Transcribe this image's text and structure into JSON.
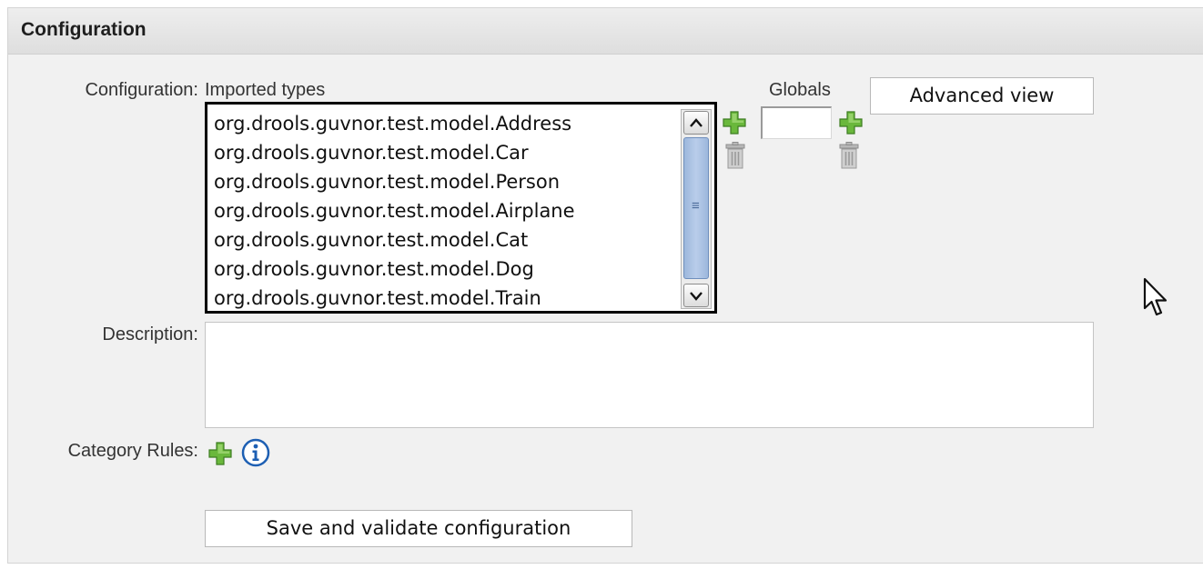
{
  "panel": {
    "title": "Configuration"
  },
  "config": {
    "label": "Configuration:",
    "imported_types_label": "Imported types",
    "imported_types": [
      "org.drools.guvnor.test.model.Address",
      "org.drools.guvnor.test.model.Car",
      "org.drools.guvnor.test.model.Person",
      "org.drools.guvnor.test.model.Airplane",
      "org.drools.guvnor.test.model.Cat",
      "org.drools.guvnor.test.model.Dog",
      "org.drools.guvnor.test.model.Train"
    ],
    "globals_label": "Globals",
    "globals_value": "",
    "advanced_view_label": "Advanced view"
  },
  "description": {
    "label": "Description:",
    "value": ""
  },
  "category_rules": {
    "label": "Category Rules:"
  },
  "save_button_label": "Save and validate configuration",
  "icons": {
    "add": "plus-icon",
    "remove": "trash-icon",
    "info": "info-icon",
    "scroll_up": "chevron-up-icon",
    "scroll_down": "chevron-down-icon",
    "pointer": "mouse-cursor-icon"
  },
  "colors": {
    "panel_bg": "#f1f1f1",
    "plus_green": "#5aa832",
    "info_blue": "#1d5fb3",
    "scroll_thumb": "#aac1e2"
  }
}
